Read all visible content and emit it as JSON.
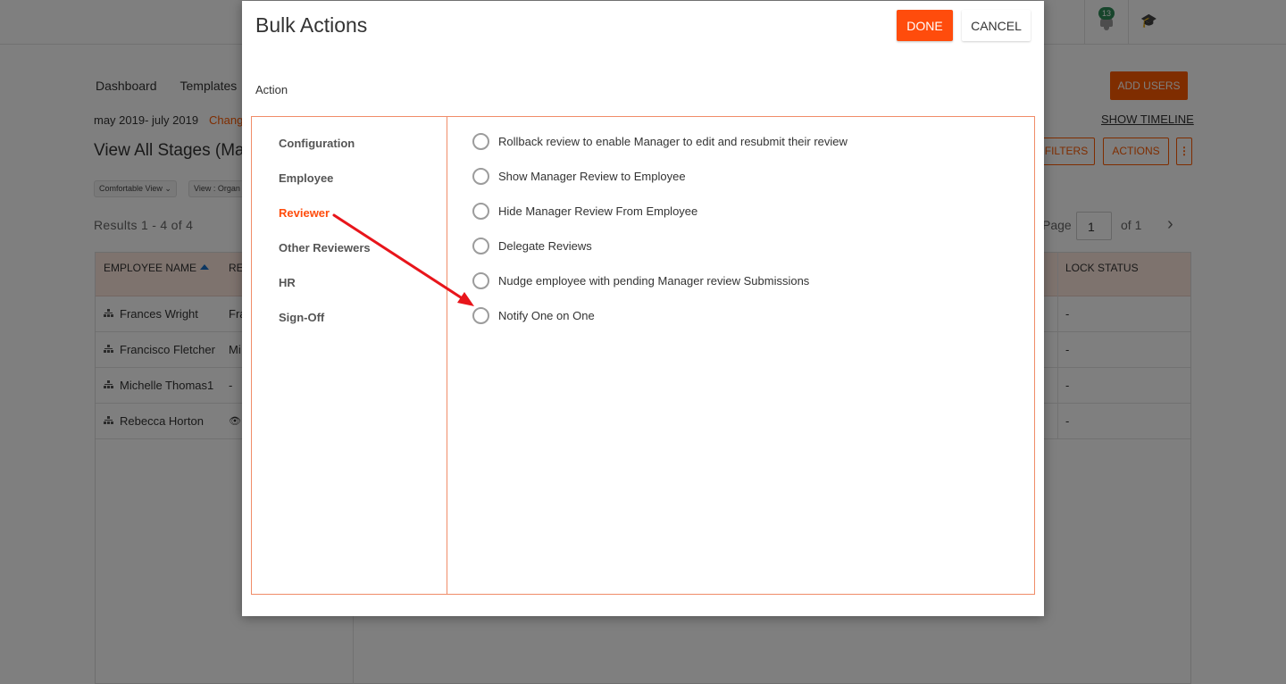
{
  "topbar": {
    "notification_count": "13",
    "colors": {
      "badge": "#2e8b57"
    },
    "icons": [
      "bell-icon",
      "graduation-cap-icon"
    ]
  },
  "background": {
    "nav": [
      "Dashboard",
      "Templates"
    ],
    "date_range": "may 2019- july 2019",
    "change_link": "Chang",
    "view_title": "View All Stages (May",
    "chips": [
      "Comfortable View",
      "View : Organ"
    ],
    "results": "Results 1 - 4 of 4",
    "add_users": "ADD USERS",
    "show_timeline": "SHOW TIMELINE",
    "filters": "FILTERS",
    "actions": "ACTIONS",
    "more": "⋮",
    "page_label": "Page",
    "page_value": "1",
    "of_label": "of 1",
    "table": {
      "headers": [
        "EMPLOYEE NAME",
        "RE",
        "LOCK STATUS"
      ],
      "rows": [
        {
          "name": "Frances Wright",
          "reviewer": "Fra",
          "lock": "-"
        },
        {
          "name": "Francisco Fletcher",
          "reviewer": "Mi",
          "lock": "-"
        },
        {
          "name": "Michelle Thomas1",
          "reviewer": "-",
          "lock": "-"
        },
        {
          "name": "Rebecca Horton",
          "reviewer": "👁",
          "lock": "-"
        }
      ]
    }
  },
  "modal": {
    "title": "Bulk Actions",
    "done_label": "DONE",
    "cancel_label": "CANCEL",
    "action_label": "Action",
    "categories": [
      "Configuration",
      "Employee",
      "Reviewer",
      "Other Reviewers",
      "HR",
      "Sign-Off"
    ],
    "active_category": "Reviewer",
    "options": [
      "Rollback review to enable Manager to edit and resubmit their review",
      "Show Manager Review to Employee",
      "Hide Manager Review From Employee",
      "Delegate Reviews",
      "Nudge employee with pending Manager review Submissions",
      "Notify One on One"
    ],
    "colors": {
      "accent": "#ff4c0c",
      "panel_border": "#f08c68",
      "annotation_arrow": "#e8151b"
    }
  }
}
